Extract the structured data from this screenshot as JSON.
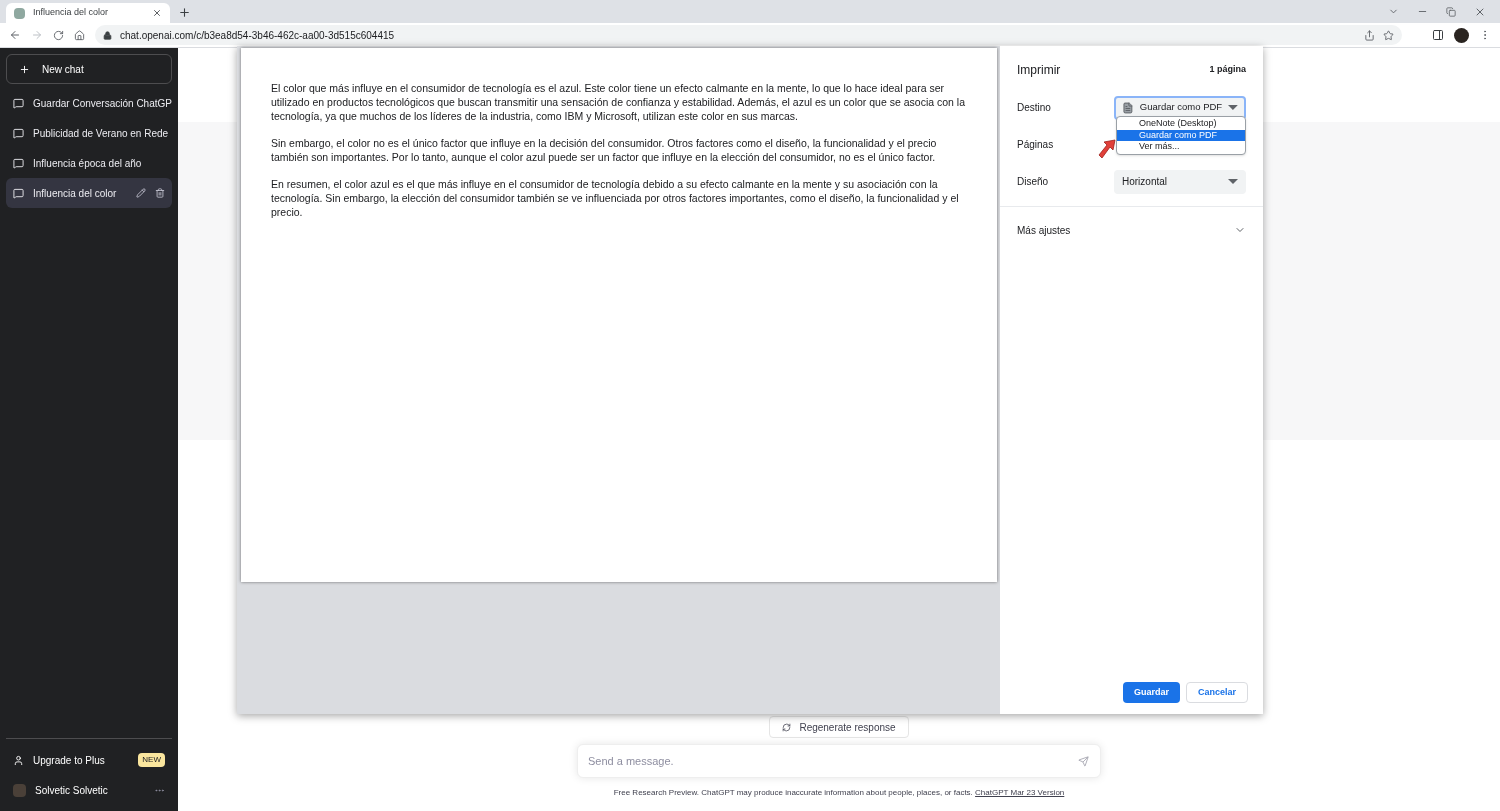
{
  "browser": {
    "tab": {
      "title": "Influencia del color"
    },
    "address": "chat.openai.com/c/b3ea8d54-3b46-462c-aa00-3d515c604415"
  },
  "sidebar": {
    "new_chat": "New chat",
    "items": [
      {
        "label": "Guardar Conversación ChatGP",
        "selected": false
      },
      {
        "label": "Publicidad de Verano en Rede",
        "selected": false
      },
      {
        "label": "Influencia época del año",
        "selected": false
      },
      {
        "label": "Influencia del color",
        "selected": true
      }
    ],
    "upgrade": {
      "label": "Upgrade to Plus",
      "badge": "NEW"
    },
    "user": "Solvetic Solvetic"
  },
  "chat": {
    "regenerate": "Regenerate response",
    "input": {
      "placeholder": "Send a message."
    },
    "footer": {
      "text": "Free Research Preview. ChatGPT may produce inaccurate information about people, places, or facts.",
      "link": "ChatGPT Mar 23 Version"
    }
  },
  "print_dialog": {
    "title": "Imprimir",
    "page_count": "1 página",
    "preview_paragraphs": [
      "El color que más influye en el consumidor de tecnología es el azul. Este color tiene un efecto calmante en la mente, lo que lo hace ideal para ser utilizado en productos tecnológicos que buscan transmitir una sensación de confianza y estabilidad. Además, el azul es un color que se asocia con la tecnología, ya que muchos de los líderes de la industria, como IBM y Microsoft, utilizan este color en sus marcas.",
      "Sin embargo, el color no es el único factor que influye en la decisión del consumidor. Otros factores como el diseño, la funcionalidad y el precio también son importantes. Por lo tanto, aunque el color azul puede ser un factor que influye en la elección del consumidor, no es el único factor.",
      "En resumen, el color azul es el que más influye en el consumidor de tecnología debido a su efecto calmante en la mente y su asociación con la tecnología. Sin embargo, la elección del consumidor también se ve influenciada por otros factores importantes, como el diseño, la funcionalidad y el precio."
    ],
    "settings": [
      {
        "label": "Destino",
        "kind": "destination",
        "value": "Guardar como PDF"
      },
      {
        "label": "Páginas",
        "kind": "covered"
      },
      {
        "label": "Diseño",
        "kind": "select",
        "value": "Horizontal"
      }
    ],
    "dropdown": [
      {
        "label": "OneNote (Desktop)",
        "selected": false
      },
      {
        "label": "Guardar como PDF",
        "selected": true
      },
      {
        "label": "Ver más...",
        "selected": false
      }
    ],
    "more_settings": {
      "label": "Más ajustes",
      "expanded": false
    },
    "buttons": [
      {
        "label": "Guardar",
        "kind": "primary"
      },
      {
        "label": "Cancelar",
        "kind": "secondary"
      }
    ]
  }
}
